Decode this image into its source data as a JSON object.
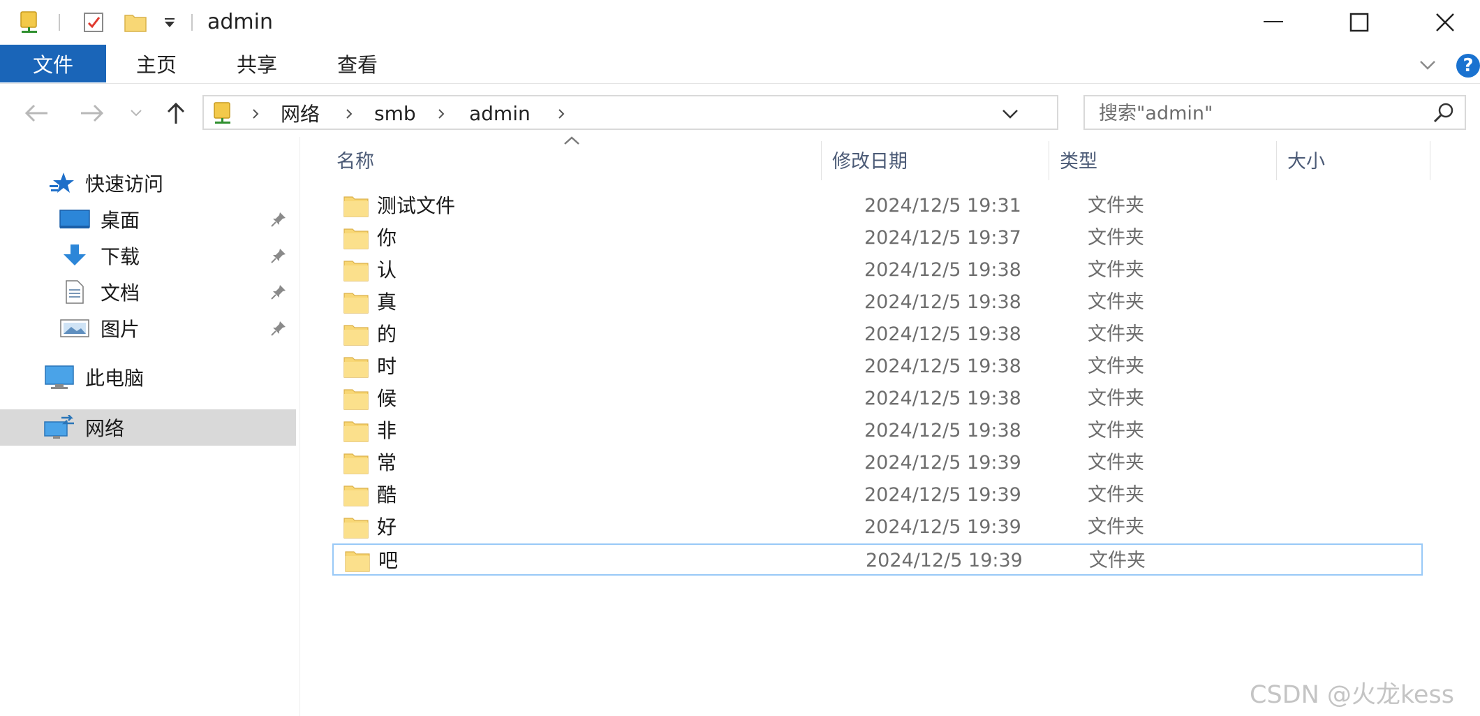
{
  "window": {
    "title": "admin",
    "quick_access_toolbar": [
      "network-drive-icon",
      "properties-checkbox-icon",
      "new-folder-icon",
      "customize-dropdown-icon"
    ],
    "controls": [
      "minimize",
      "maximize",
      "close"
    ]
  },
  "ribbon": {
    "tabs": [
      {
        "label": "文件",
        "active": true
      },
      {
        "label": "主页"
      },
      {
        "label": "共享"
      },
      {
        "label": "查看"
      }
    ]
  },
  "address_bar": {
    "breadcrumbs": [
      "网络",
      "smb",
      "admin"
    ],
    "search_placeholder": "搜索\"admin\""
  },
  "navigation_pane": {
    "quick_access": {
      "label": "快速访问",
      "items": [
        {
          "label": "桌面",
          "icon": "desktop-icon",
          "pinned": true
        },
        {
          "label": "下载",
          "icon": "download-icon",
          "pinned": true
        },
        {
          "label": "文档",
          "icon": "document-icon",
          "pinned": true
        },
        {
          "label": "图片",
          "icon": "pictures-icon",
          "pinned": true
        }
      ]
    },
    "this_pc": {
      "label": "此电脑"
    },
    "network": {
      "label": "网络",
      "selected": true
    }
  },
  "file_list": {
    "columns": [
      "名称",
      "修改日期",
      "类型",
      "大小"
    ],
    "sorted_by": "名称",
    "rows": [
      {
        "name": "测试文件",
        "modified": "2024/12/5 19:31",
        "type": "文件夹",
        "size": ""
      },
      {
        "name": "你",
        "modified": "2024/12/5 19:37",
        "type": "文件夹",
        "size": ""
      },
      {
        "name": "认",
        "modified": "2024/12/5 19:38",
        "type": "文件夹",
        "size": ""
      },
      {
        "name": "真",
        "modified": "2024/12/5 19:38",
        "type": "文件夹",
        "size": ""
      },
      {
        "name": "的",
        "modified": "2024/12/5 19:38",
        "type": "文件夹",
        "size": ""
      },
      {
        "name": "时",
        "modified": "2024/12/5 19:38",
        "type": "文件夹",
        "size": ""
      },
      {
        "name": "候",
        "modified": "2024/12/5 19:38",
        "type": "文件夹",
        "size": ""
      },
      {
        "name": "非",
        "modified": "2024/12/5 19:38",
        "type": "文件夹",
        "size": ""
      },
      {
        "name": "常",
        "modified": "2024/12/5 19:39",
        "type": "文件夹",
        "size": ""
      },
      {
        "name": "酷",
        "modified": "2024/12/5 19:39",
        "type": "文件夹",
        "size": ""
      },
      {
        "name": "好",
        "modified": "2024/12/5 19:39",
        "type": "文件夹",
        "size": ""
      },
      {
        "name": "吧",
        "modified": "2024/12/5 19:39",
        "type": "文件夹",
        "size": "",
        "selected": true
      }
    ]
  },
  "watermark": "CSDN @火龙kess",
  "colors": {
    "ribbon_file_tab": "#1a65b8",
    "selection_border": "#99c9f7",
    "nav_selected": "#d9d9d9",
    "folder_yellow": "#f8d775",
    "column_header_text": "#4b5a76"
  }
}
